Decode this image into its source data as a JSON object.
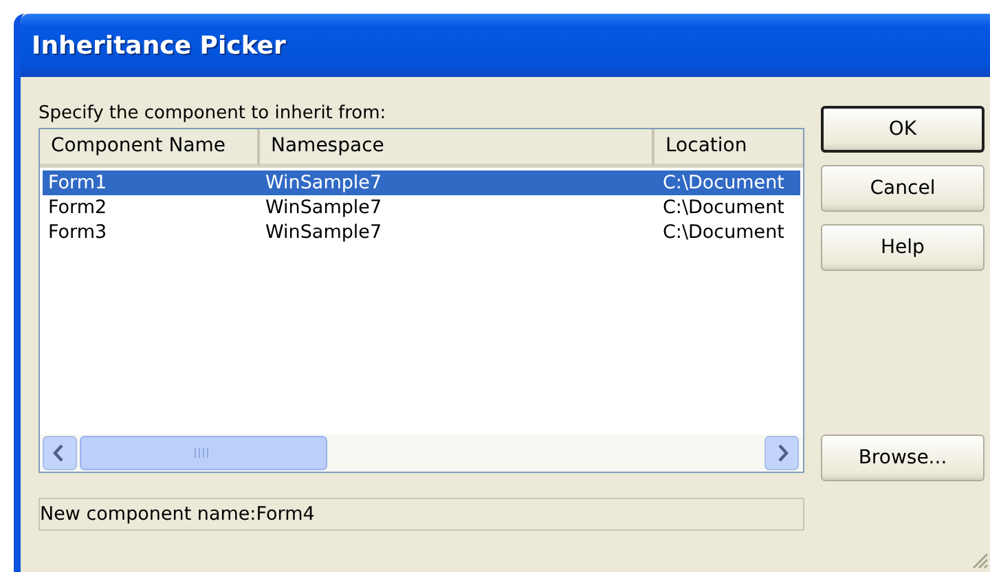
{
  "window": {
    "title": "Inheritance Picker"
  },
  "prompt": "Specify the component to inherit from:",
  "table": {
    "columns": [
      "Component Name",
      "Namespace",
      "Location"
    ],
    "rows": [
      {
        "cells": [
          "Form1",
          "WinSample7",
          "C:\\Document"
        ],
        "selected": true
      },
      {
        "cells": [
          "Form2",
          "WinSample7",
          "C:\\Document"
        ],
        "selected": false
      },
      {
        "cells": [
          "Form3",
          "WinSample7",
          "C:\\Document"
        ],
        "selected": false
      }
    ]
  },
  "status_field": "New component name:Form4",
  "buttons": [
    {
      "label": "OK",
      "default": true
    },
    {
      "label": "Cancel",
      "default": false
    },
    {
      "label": "Help",
      "default": false
    }
  ],
  "browse_button": "Browse..."
}
